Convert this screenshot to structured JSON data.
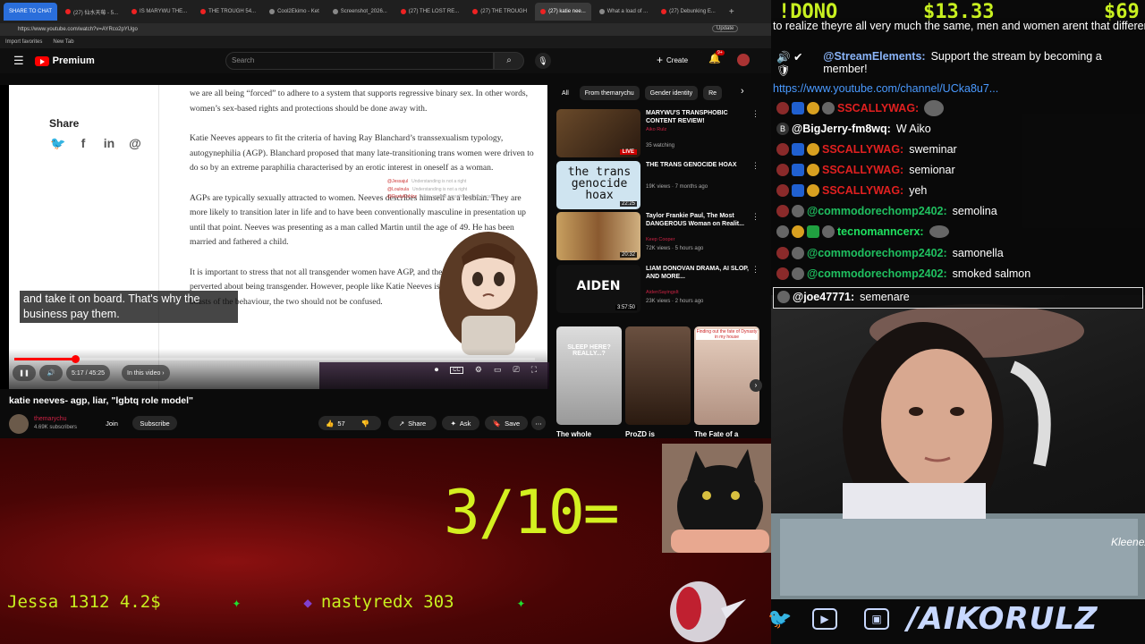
{
  "browser": {
    "tabs": [
      {
        "label": "SHARE TO CHAT"
      },
      {
        "label": "(27) 仙水天莓 - 5..."
      },
      {
        "label": "IS MARYWU THE..."
      },
      {
        "label": "THE TROUGH 54..."
      },
      {
        "label": "Cool2Ekimo - Ket"
      },
      {
        "label": "Screenshot_2026..."
      },
      {
        "label": "(27) THE LOST RE..."
      },
      {
        "label": "(27) THE TROUGH"
      },
      {
        "label": "(27) katie nee..."
      },
      {
        "label": "What a load of ..."
      },
      {
        "label": "(27) Debunking E..."
      }
    ],
    "url": "https://www.youtube.com/watch?v=AYRco2pYUgo",
    "bookmarks": [
      "Import favorites",
      "New Tab"
    ],
    "update_label": "Update"
  },
  "youtube": {
    "logo_text": "Premium",
    "search_placeholder": "Search",
    "create_label": "Create",
    "notif_count": "9+",
    "chips": [
      "All",
      "From themarychu",
      "Gender identity",
      "Re"
    ]
  },
  "article": {
    "share_title": "Share",
    "share_icons": [
      "twitter-icon",
      "facebook-icon",
      "linkedin-icon",
      "at-icon"
    ],
    "paragraphs": [
      "we are all being “forced” to adhere to a system that supports regressive binary sex. In other words, women’s sex-based rights and protections should be done away with.",
      "Katie Neeves appears to fit the criteria of having Ray Blanchard’s transsexualism typology, autogynephilia (AGP). Blanchard proposed that many late-transitioning trans women were driven to do so by an extreme paraphilia characterised by an erotic interest in oneself as a woman.",
      "AGPs are typically sexually attracted to women. Neeves describes himself as a lesbian. They are more likely to transition later in life and to have been conventionally masculine in presentation up until that point. Neeves was presenting as a man called Martin until the age of 49. He has been married and fathered a child.",
      "It is important to stress that not all transgender women have AGP, and there is nothing inherently perverted about being transgender. However, people like Katie Neeves is both transgender and boasts of the behaviour, the two should not be confused."
    ],
    "overlay_names": [
      {
        "name": "@Jessajul",
        "msg": "Understanding is not a right"
      },
      {
        "name": "@Louloula",
        "msg": "Understanding is not a right"
      },
      {
        "name": "@RustyKohlzz",
        "msg": "story, second paraphilia which became"
      }
    ]
  },
  "player": {
    "caption": "and take it on board. That's why the business pay them.",
    "time": "5:17 / 45:25",
    "chapter": "In this video",
    "progress": 0.116
  },
  "video": {
    "title": "katie neeves- agp, liar, \"lgbtq role model\"",
    "channel": "themarychu",
    "subscribers": "4.69K subscribers",
    "join_label": "Join",
    "subscribe_label": "Subscribe",
    "likes": "57",
    "share_label": "Share",
    "ask_label": "Ask",
    "save_label": "Save"
  },
  "recommendations": [
    {
      "title": "MARYWU'S TRANSPHOBIC CONTENT REVIEW!",
      "channel": "Aiko Rulz",
      "meta": "35 watching",
      "badge": "LIVE"
    },
    {
      "title": "THE TRANS GENOCIDE HOAX",
      "channel": "",
      "meta": "19K views · 7 months ago",
      "badge": "22:25",
      "thumb_text": "the trans genocide hoax"
    },
    {
      "title": "Taylor Frankie Paul, The Most DANGEROUS Woman on Realit...",
      "channel": "Keep Cooper",
      "meta": "72K views · 5 hours ago",
      "badge": "20:32"
    },
    {
      "title": "LIAM DONOVAN DRAMA, AI SLOP, AND MORE...",
      "channel": "AidenSayingsIt",
      "meta": "23K views · 2 hours ago",
      "badge": "3:57:50",
      "thumb_text": "AIDEN"
    }
  ],
  "shorts": [
    {
      "label": "The whole",
      "thumb_text": "SLEEP HERE? REALLY...?"
    },
    {
      "label": "ProZD is",
      "thumb_text": ""
    },
    {
      "label": "The Fate of a",
      "thumb_text": "Finding out the fate of Dynasty in my house"
    }
  ],
  "stream": {
    "score": "3/10=",
    "ticker": [
      {
        "text": "Jessa 1312 4.2$"
      },
      {
        "text": "nastyredx 303"
      }
    ],
    "dono_label": "!DONO",
    "dono_amount_1": "$13.33",
    "dono_amount_2": "$69",
    "handle": "/AIKORULZ"
  },
  "chat": {
    "lines": [
      {
        "user": "",
        "text": "to realize theyre all very much the same, men and women arent that different haha",
        "color": "#ffffff"
      },
      {
        "user": "@StreamElements:",
        "text": "Support the stream by becoming a member!",
        "color": "#8ab4f8"
      },
      {
        "user": "",
        "text": "https://www.youtube.com/channel/UCka8u7...",
        "color": "#4a9aff"
      },
      {
        "user": "SSCALLYWAG:",
        "text": "",
        "color": "#e02020"
      },
      {
        "user": "@BigJerry-fm8wq:",
        "text": "W Aiko",
        "color": "#ffffff"
      },
      {
        "user": "SSCALLYWAG:",
        "text": "sweminar",
        "color": "#e02020"
      },
      {
        "user": "SSCALLYWAG:",
        "text": "semionar",
        "color": "#e02020"
      },
      {
        "user": "SSCALLYWAG:",
        "text": "yeh",
        "color": "#e02020"
      },
      {
        "user": "@commodorechomp2402:",
        "text": "semolina",
        "color": "#20c060"
      },
      {
        "user": "tecnomanncerx:",
        "text": "",
        "color": "#20e060"
      },
      {
        "user": "@commodorechomp2402:",
        "text": "samonella",
        "color": "#20c060"
      },
      {
        "user": "@commodorechomp2402:",
        "text": "smoked salmon",
        "color": "#20c060"
      },
      {
        "user": "@joe47771:",
        "text": "semenare",
        "color": "#ffffff"
      }
    ]
  },
  "colors": {
    "accent_green": "#c8f020",
    "yt_red": "#ff0000",
    "chat_red": "#e02020",
    "chat_green": "#20c060"
  }
}
